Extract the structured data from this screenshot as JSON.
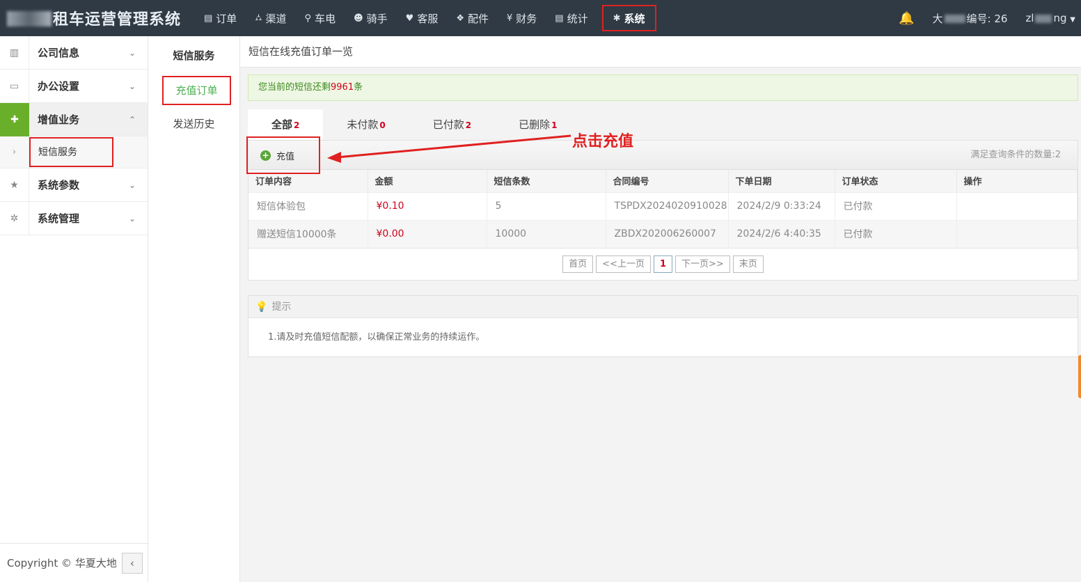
{
  "app": {
    "title": "租车运营管理系统"
  },
  "nav": {
    "items": [
      {
        "icon": "list-icon",
        "glyph": "▤",
        "label": "订单"
      },
      {
        "icon": "sitemap-icon",
        "glyph": "⛼",
        "label": "渠道"
      },
      {
        "icon": "bicycle-icon",
        "glyph": "⚲",
        "label": "车电"
      },
      {
        "icon": "users-icon",
        "glyph": "☻",
        "label": "骑手"
      },
      {
        "icon": "heart-icon",
        "glyph": "♥",
        "label": "客服"
      },
      {
        "icon": "cubes-icon",
        "glyph": "❖",
        "label": "配件"
      },
      {
        "icon": "yen-icon",
        "glyph": "¥",
        "label": "财务"
      },
      {
        "icon": "list-icon",
        "glyph": "▤",
        "label": "统计"
      },
      {
        "icon": "gear-icon",
        "glyph": "✱",
        "label": "系统"
      }
    ],
    "active_index": 8
  },
  "topright": {
    "user_prefix": "大",
    "user_suffix": "编号: 26",
    "account_prefix": "zl",
    "account_suffix": "ng"
  },
  "sidebar": {
    "items": [
      {
        "label": "公司信息",
        "glyph": "▥"
      },
      {
        "label": "办公设置",
        "glyph": "▭"
      },
      {
        "label": "增值业务",
        "glyph": "✚"
      },
      {
        "label": "系统参数",
        "glyph": "★"
      },
      {
        "label": "系统管理",
        "glyph": "✲"
      }
    ],
    "open_sub": {
      "label": "短信服务"
    },
    "copyright": "Copyright © 华夏大地"
  },
  "subnav": {
    "title": "短信服务",
    "items": [
      "充值订单",
      "发送历史"
    ]
  },
  "main": {
    "heading": "短信在线充值订单一览",
    "notice_prefix": "您当前的短信还剩",
    "notice_count": "9961",
    "notice_suffix": "条",
    "tabs": [
      {
        "label": "全部",
        "count": "2"
      },
      {
        "label": "未付款",
        "count": "0"
      },
      {
        "label": "已付款",
        "count": "2"
      },
      {
        "label": "已删除",
        "count": "1"
      }
    ],
    "recharge_label": "充值",
    "result_count": "满足查询条件的数量:2",
    "columns": [
      "订单内容",
      "金额",
      "短信条数",
      "合同编号",
      "下单日期",
      "订单状态",
      "操作"
    ],
    "rows": [
      [
        "短信体验包",
        "¥0.10",
        "5",
        "TSPDX2024020910028",
        "2024/2/9 0:33:24",
        "已付款",
        ""
      ],
      [
        "赠送短信10000条",
        "¥0.00",
        "10000",
        "ZBDX202006260007",
        "2024/2/6 4:40:35",
        "已付款",
        ""
      ]
    ],
    "pager": [
      "首页",
      "<<上一页",
      "1",
      "下一页>>",
      "末页"
    ],
    "tips_title": "提示",
    "tips_text": "1.请及时充值短信配额，以确保正常业务的持续运作。"
  },
  "annotation": {
    "text": "点击充值",
    "color": "#e02020"
  }
}
